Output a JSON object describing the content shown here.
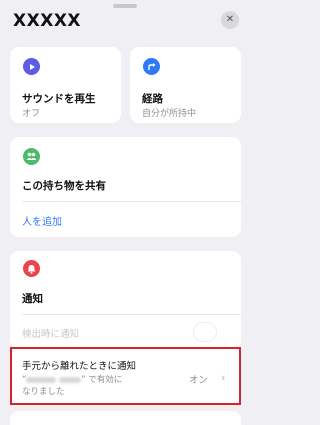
{
  "header": {
    "title": "XXXXX",
    "close_icon": "xmark-icon"
  },
  "colors": {
    "play": "#5c5ce6",
    "directions": "#2f7bf5",
    "share": "#4cbb6c",
    "notify": "#e8454e",
    "highlight_border": "#d9232b",
    "link": "#2f7bf5"
  },
  "sound": {
    "title": "サウンドを再生",
    "status": "オフ",
    "icon": "play-icon"
  },
  "directions": {
    "title": "経路",
    "subtitle": "自分が所持中",
    "icon": "arrow-turn-icon"
  },
  "share": {
    "title": "この持ち物を共有",
    "add_people": "人を追加",
    "icon": "people-icon"
  },
  "notifications": {
    "title": "通知",
    "notify_when_found": "検出時に通知",
    "icon": "bell-icon",
    "left_behind": {
      "title": "手元から離れたときに通知",
      "desc_quote_open": "“",
      "desc_suffix": "” で有効に",
      "desc_line2": "なりました",
      "value": "オン"
    }
  }
}
